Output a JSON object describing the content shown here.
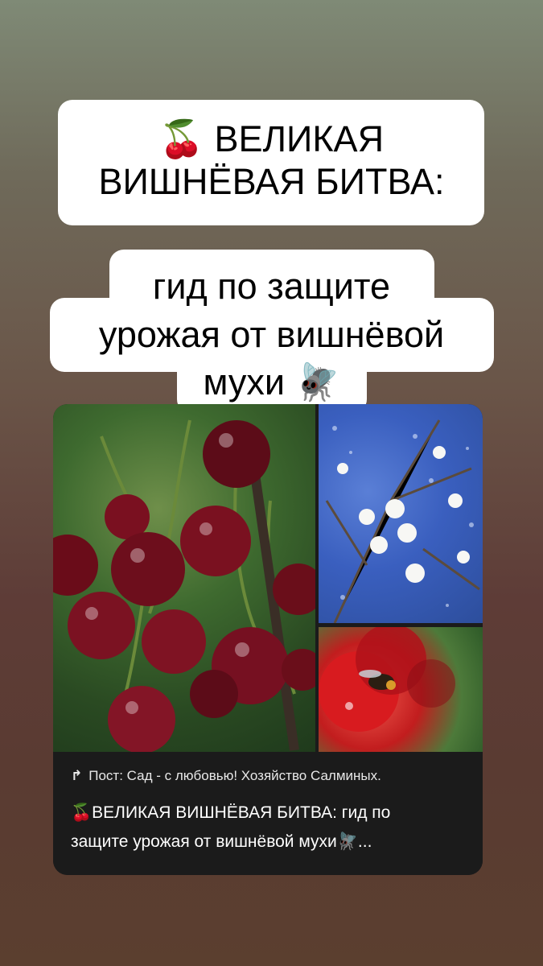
{
  "title": {
    "line1": "🍒 ВЕЛИКАЯ",
    "line2": "ВИШНЁВАЯ БИТВА:",
    "line3": "гид по защите",
    "line4": "урожая от вишнёвой",
    "line5": "мухи 🪰"
  },
  "post": {
    "repost_icon": "repost-arrow-icon",
    "source": "Пост: Сад - с любовью! Хозяйство Салминых.",
    "description_line1": "🍒ВЕЛИКАЯ ВИШНЁВАЯ БИТВА: гид по",
    "description_line2": "защите урожая от вишнёвой мухи🪰..."
  },
  "colors": {
    "background_top": "#7f8a76",
    "background_bottom": "#5b3f2f",
    "caption_bg": "#1b1b1b",
    "cherry_red": "#7a0f1a"
  }
}
